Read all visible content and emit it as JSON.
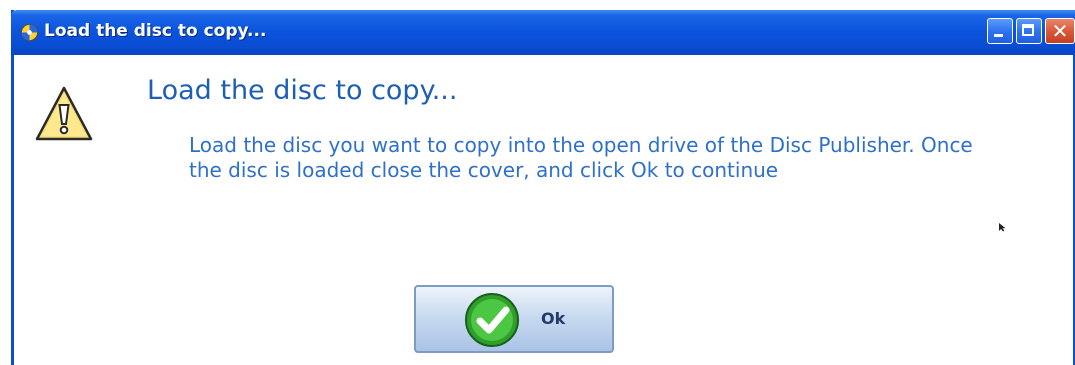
{
  "window": {
    "title": "Load the disc to copy...",
    "controls": {
      "minimize_icon": "minimize-icon",
      "maximize_icon": "maximize-icon",
      "close_icon": "close-icon",
      "close_glyph": "✕"
    }
  },
  "dialog": {
    "icon": "warning-icon",
    "heading": "Load the disc to copy...",
    "message": "Load the disc you want to copy into the open drive of the Disc Publisher. Once the disc is loaded close the cover, and click Ok to continue"
  },
  "ok_button": {
    "label": "Ok",
    "icon": "checkmark-icon"
  },
  "colors": {
    "titlebar": "#0a4cd3",
    "heading": "#1f5fb3",
    "message": "#2f71c9",
    "close_button": "#d95a3a",
    "check_green": "#2f9e2a"
  }
}
